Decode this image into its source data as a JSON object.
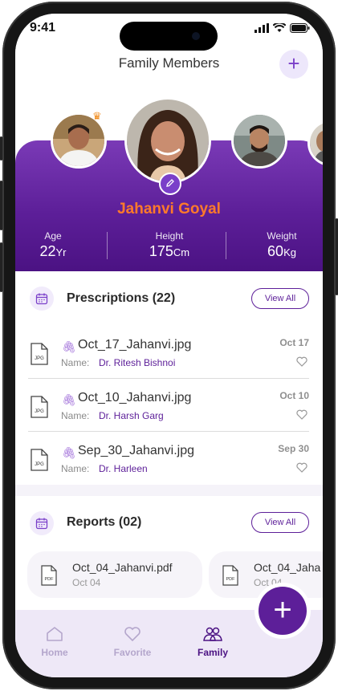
{
  "status_bar": {
    "time": "9:41"
  },
  "header": {
    "title": "Family Members",
    "add_icon": "+"
  },
  "profile": {
    "name": "Jahanvi Goyal",
    "stats": [
      {
        "label": "Age",
        "value": "22",
        "unit": "Yr"
      },
      {
        "label": "Height",
        "value": "175",
        "unit": "Cm"
      },
      {
        "label": "Weight",
        "value": "60",
        "unit": "Kg"
      }
    ]
  },
  "prescriptions": {
    "title": "Prescriptions (22)",
    "view_all": "View All",
    "items": [
      {
        "file": "Oct_17_Jahanvi.jpg",
        "name_label": "Name:",
        "doctor": "Dr. Ritesh Bishnoi",
        "date": "Oct 17",
        "type": "JPG"
      },
      {
        "file": "Oct_10_Jahanvi.jpg",
        "name_label": "Name:",
        "doctor": "Dr. Harsh Garg",
        "date": "Oct 10",
        "type": "JPG"
      },
      {
        "file": "Sep_30_Jahanvi.jpg",
        "name_label": "Name:",
        "doctor": "Dr. Harleen",
        "date": "Sep 30",
        "type": "JPG"
      }
    ]
  },
  "reports": {
    "title": "Reports (02)",
    "view_all": "View All",
    "items": [
      {
        "file": "Oct_04_Jahanvi.pdf",
        "date": "Oct 04",
        "type": "PDF"
      },
      {
        "file": "Oct_04_Jaha",
        "date": "Oct 04",
        "type": "PDF"
      }
    ]
  },
  "fab": {
    "icon": "+"
  },
  "tabs": [
    {
      "label": "Home",
      "icon": "home-icon"
    },
    {
      "label": "Favorite",
      "icon": "heart-icon"
    },
    {
      "label": "Family",
      "icon": "family-icon"
    }
  ],
  "colors": {
    "accent": "#5d1f99",
    "name": "#ff7a2a",
    "banner": "#6a2aa8"
  }
}
